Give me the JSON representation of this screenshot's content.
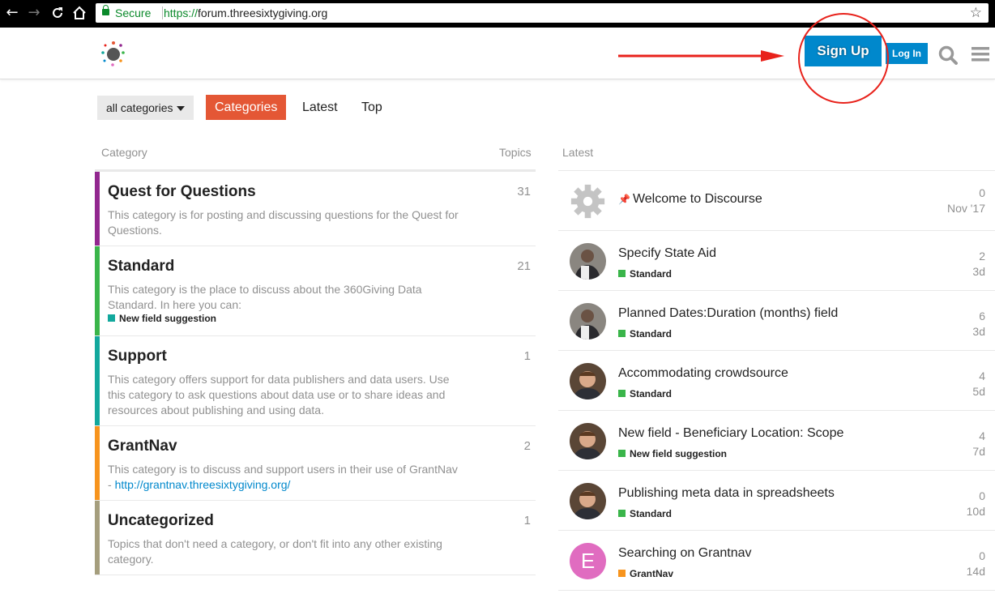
{
  "browser": {
    "secure_label": "Secure",
    "url_protocol": "https://",
    "url_host": "forum.threesixtygiving.org"
  },
  "header": {
    "signup_label": "Sign Up",
    "login_label": "Log In"
  },
  "nav": {
    "dropdown_label": "all categories",
    "tabs": [
      "Categories",
      "Latest",
      "Top"
    ],
    "active_tab": "Categories"
  },
  "categories_table": {
    "col_category": "Category",
    "col_topics": "Topics",
    "rows": [
      {
        "name": "Quest for Questions",
        "description": "This category is for posting and discussing questions for the Quest for Questions.",
        "topics": "31",
        "color": "#92278f"
      },
      {
        "name": "Standard",
        "description": "This category is the place to discuss about the 360Giving Data Standard. In here you can:",
        "topics": "21",
        "color": "#3ab54a",
        "subcategory": "New field suggestion",
        "subcategory_color": "#12a89d"
      },
      {
        "name": "Support",
        "description": "This category offers support for data publishers and data users. Use this category to ask questions about data use or to share ideas and resources about publishing and using data.",
        "topics": "1",
        "color": "#12a89d"
      },
      {
        "name": "GrantNav",
        "description": "This category is to discuss and support users in their use of GrantNav - ",
        "link": "http://grantnav.threesixtygiving.org/",
        "topics": "2",
        "color": "#f7941d"
      },
      {
        "name": "Uncategorized",
        "description": "Topics that don't need a category, or don't fit into any other existing category.",
        "topics": "1",
        "color": "#a59e7d"
      }
    ]
  },
  "latest": {
    "heading": "Latest",
    "topics": [
      {
        "title": "Welcome to Discourse",
        "pinned": true,
        "replies": "0",
        "age": "Nov '17",
        "avatar": "gear-icon"
      },
      {
        "title": "Specify State Aid",
        "category": "Standard",
        "category_color": "#3ab54a",
        "replies": "2",
        "age": "3d",
        "avatar": "user-photo"
      },
      {
        "title": "Planned Dates:Duration (months) field",
        "category": "Standard",
        "category_color": "#3ab54a",
        "replies": "6",
        "age": "3d",
        "avatar": "user-photo"
      },
      {
        "title": "Accommodating crowdsource",
        "category": "Standard",
        "category_color": "#3ab54a",
        "replies": "4",
        "age": "5d",
        "avatar": "user-photo"
      },
      {
        "title": "New field - Beneficiary Location: Scope",
        "category": "New field suggestion",
        "category_color": "#3ab54a",
        "replies": "4",
        "age": "7d",
        "avatar": "user-photo"
      },
      {
        "title": "Publishing meta data in spreadsheets",
        "category": "Standard",
        "category_color": "#3ab54a",
        "replies": "0",
        "age": "10d",
        "avatar": "user-photo"
      },
      {
        "title": "Searching on Grantnav",
        "category": "GrantNav",
        "category_color": "#f7941d",
        "replies": "0",
        "age": "14d",
        "avatar": "letter-avatar",
        "avatar_letter": "E",
        "avatar_color": "#e06cc0"
      }
    ]
  }
}
